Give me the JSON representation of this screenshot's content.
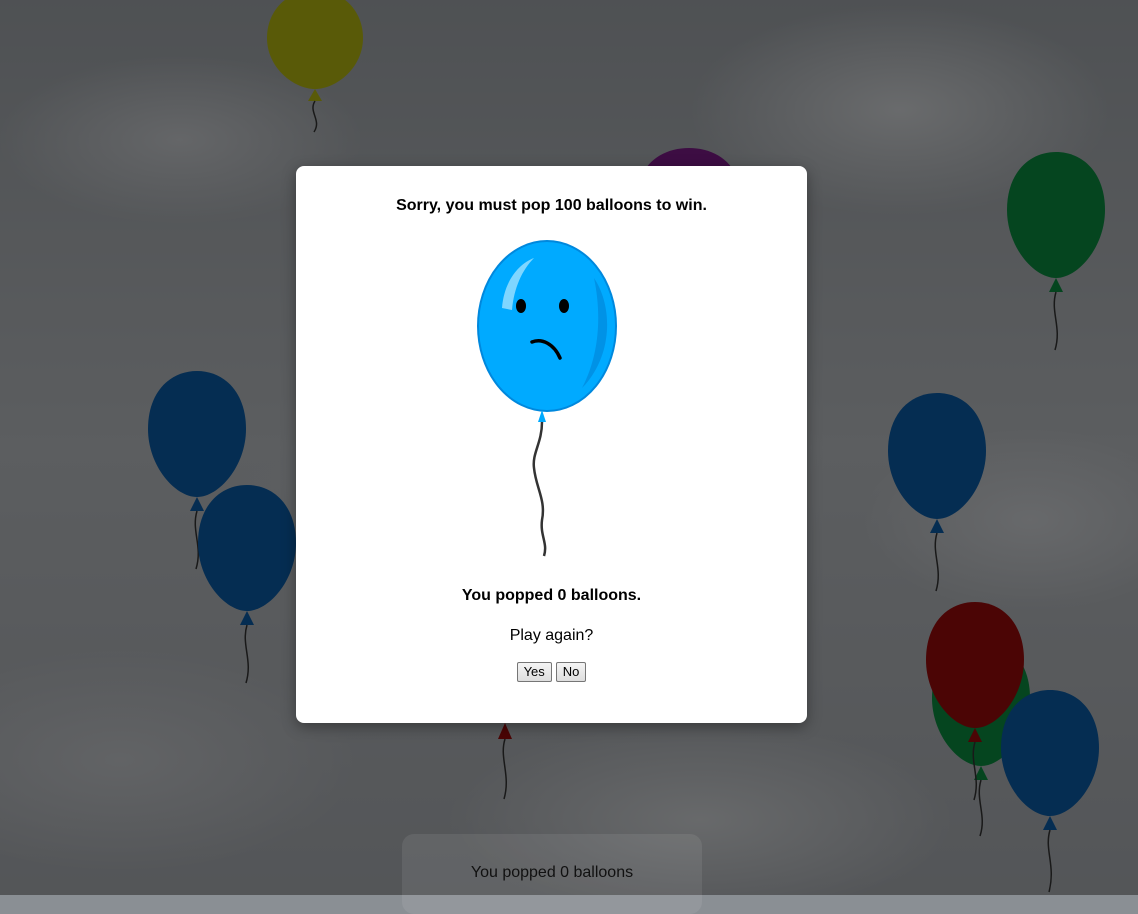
{
  "game": {
    "background": "cloudy-sky",
    "balloon_colors": {
      "yellow": "#b2b510",
      "purple": "#7a1a86",
      "green": "#0a8a3f",
      "blue": "#0a5aa4",
      "red": "#960a0a"
    },
    "background_balloons": [
      "yellow",
      "purple",
      "green",
      "blue",
      "blue",
      "blue",
      "red",
      "green",
      "red",
      "blue"
    ]
  },
  "footer": {
    "score_text": "You popped 0 balloons"
  },
  "dialog": {
    "title": "Sorry, you must pop 100 balloons to win.",
    "image": "sad-balloon-icon",
    "balloon_color": "#00aaff",
    "result_text": "You popped 0 balloons.",
    "prompt": "Play again?",
    "yes_label": "Yes",
    "no_label": "No"
  }
}
